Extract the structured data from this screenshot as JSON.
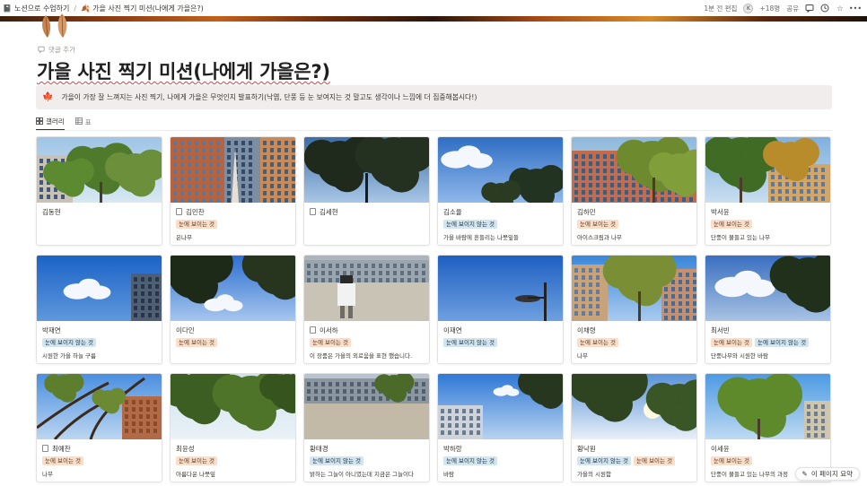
{
  "topbar": {
    "breadcrumb": [
      {
        "icon": "📓",
        "label": "노션으로 수업하기"
      },
      {
        "icon": "🍂",
        "label": "가을 사진 찍기 미션(나에게 가을은?)"
      }
    ],
    "edited": "1분 전 편집",
    "avatar": "K",
    "count": "+18명",
    "share": "공유"
  },
  "page": {
    "add_comment": "댓글 추가",
    "title": "가을 사진 찍기 미션(나에게 가을은?)",
    "callout": "가을이 가장 잘 느껴지는 사진 찍기, 나에게 가을은 무엇인지 발표하기(낙엽, 단풍 등 눈 보여지는 것 말고도 생각이나 느낌에 더 집중해봅시다!)",
    "callout_icon": "🍁"
  },
  "tabs": [
    {
      "label": "갤러리",
      "icon": "gallery-icon",
      "active": true
    },
    {
      "label": "표",
      "icon": "table-icon",
      "active": false
    }
  ],
  "tag_labels": {
    "visible": "눈에 보이는 것",
    "invisible": "눈에 보이지 않는 것"
  },
  "cards": [
    {
      "name": "김동현",
      "doc": false,
      "tags": [],
      "desc": "",
      "thumb": "trees-green"
    },
    {
      "name": "김민찬",
      "doc": true,
      "tags": [
        "visible"
      ],
      "desc": "은나무",
      "thumb": "building-tree"
    },
    {
      "name": "김세현",
      "doc": true,
      "tags": [],
      "desc": "",
      "thumb": "tree-silhouette"
    },
    {
      "name": "김소율",
      "doc": false,
      "tags": [
        "invisible"
      ],
      "desc": "가을 바람에 흔들리는 나뭇잎들",
      "thumb": "sky-cloud-tree"
    },
    {
      "name": "김하민",
      "doc": false,
      "tags": [
        "visible"
      ],
      "desc": "아이스크림과 나무",
      "thumb": "red-building-tree"
    },
    {
      "name": "박서윤",
      "doc": false,
      "tags": [
        "visible"
      ],
      "desc": "단풍이 물들고 있는 나무",
      "thumb": "tree-building"
    },
    {
      "name": "박재연",
      "doc": false,
      "tags": [
        "invisible"
      ],
      "desc": "시원한 가을 하늘 구름",
      "thumb": "blue-sky-cloud"
    },
    {
      "name": "이다인",
      "doc": false,
      "tags": [
        "visible"
      ],
      "desc": "",
      "thumb": "tree-sky"
    },
    {
      "name": "이서하",
      "doc": true,
      "tags": [
        "visible"
      ],
      "desc": "이 장품은 가을의 외로움을 표현 했습니다.",
      "thumb": "playground-boy"
    },
    {
      "name": "이재연",
      "doc": false,
      "tags": [
        "invisible"
      ],
      "desc": "",
      "thumb": "lamp-sky"
    },
    {
      "name": "이채령",
      "doc": false,
      "tags": [
        "visible"
      ],
      "desc": "나무",
      "thumb": "buildings-tree"
    },
    {
      "name": "최서빈",
      "doc": false,
      "tags": [
        "visible",
        "invisible"
      ],
      "desc": "단풍나무와 시원한 바람",
      "thumb": "cloud-tree"
    },
    {
      "name": "최예찬",
      "doc": true,
      "tags": [
        "visible"
      ],
      "desc": "나무",
      "thumb": "branches-brick"
    },
    {
      "name": "최윤성",
      "doc": false,
      "tags": [
        "visible"
      ],
      "desc": "아름다운 나뭇잎",
      "thumb": "leaves-canopy"
    },
    {
      "name": "황태경",
      "doc": false,
      "tags": [
        "invisible"
      ],
      "desc": "밝하는 그늘이 아니였는데 지금은 그늘이다",
      "thumb": "field-buildings"
    },
    {
      "name": "박하랑",
      "doc": false,
      "tags": [
        "invisible"
      ],
      "desc": "바람",
      "thumb": "apartment-sky"
    },
    {
      "name": "황낙원",
      "doc": false,
      "tags": [
        "invisible",
        "visible"
      ],
      "desc": "가을의 시원함",
      "thumb": "sun-tree"
    },
    {
      "name": "이세윤",
      "doc": false,
      "tags": [
        "visible"
      ],
      "desc": "단풍이 물들고 있는 나무의 과정",
      "thumb": "tree-building-green"
    }
  ],
  "summary_button": "이 페이지 요약"
}
